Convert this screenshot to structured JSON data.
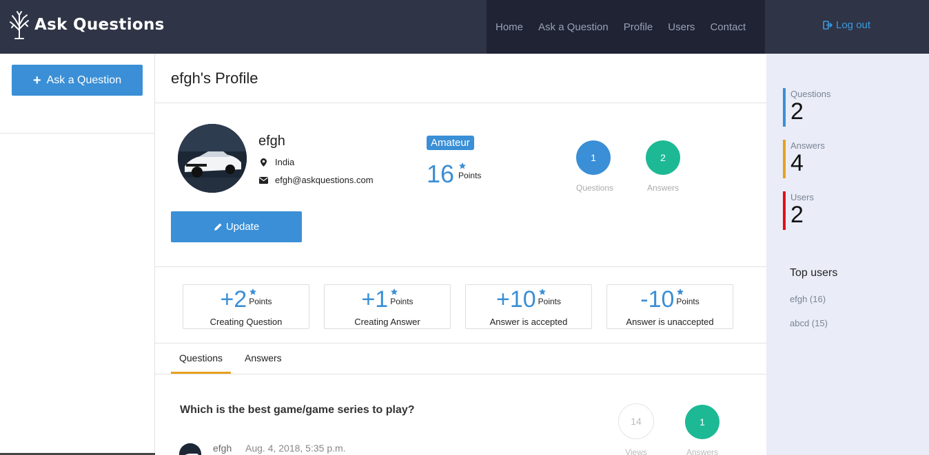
{
  "header": {
    "logo_text": "Ask Questions",
    "nav": [
      "Home",
      "Ask a Question",
      "Profile",
      "Users",
      "Contact"
    ],
    "logout_label": "Log out"
  },
  "left": {
    "ask_button_label": "Ask a Question"
  },
  "profile": {
    "page_title": "efgh's Profile",
    "username": "efgh",
    "location": "India",
    "email": "efgh@askquestions.com",
    "rank_badge": "Amateur",
    "points": "16",
    "points_label": "Points",
    "questions_count": "1",
    "questions_label": "Questions",
    "answers_count": "2",
    "answers_label": "Answers",
    "update_button_label": "Update"
  },
  "point_rules": [
    {
      "value": "+2",
      "unit": "Points",
      "description": "Creating Question"
    },
    {
      "value": "+1",
      "unit": "Points",
      "description": "Creating Answer"
    },
    {
      "value": "+10",
      "unit": "Points",
      "description": "Answer is accepted"
    },
    {
      "value": "-10",
      "unit": "Points",
      "description": "Answer is unaccepted"
    }
  ],
  "tabs": [
    "Questions",
    "Answers"
  ],
  "active_tab": "Questions",
  "question_list": [
    {
      "title": "Which is the best game/game series to play?",
      "user": "efgh",
      "date": "Aug. 4, 2018, 5:35 p.m.",
      "views": "14",
      "views_label": "Views",
      "answers": "1",
      "answers_label": "Answers"
    }
  ],
  "site_stats": [
    {
      "label": "Questions",
      "value": "2",
      "color": "#3a8fd6"
    },
    {
      "label": "Answers",
      "value": "4",
      "color": "#e8a020"
    },
    {
      "label": "Users",
      "value": "2",
      "color": "#e0101a"
    }
  ],
  "top_users": {
    "title": "Top users",
    "users": [
      "efgh (16)",
      "abcd (15)"
    ]
  },
  "colors": {
    "header_bg": "#2f3446",
    "nav_bg": "#1f2333",
    "accent_blue": "#3a8fd6",
    "accent_green": "#1db995",
    "accent_orange": "#e8a020",
    "sidebar_bg": "#eaedf7"
  },
  "icons": [
    "tree-logo-icon",
    "logout-icon",
    "plus-icon",
    "map-pin-icon",
    "envelope-icon",
    "star-icon",
    "pencil-icon"
  ]
}
